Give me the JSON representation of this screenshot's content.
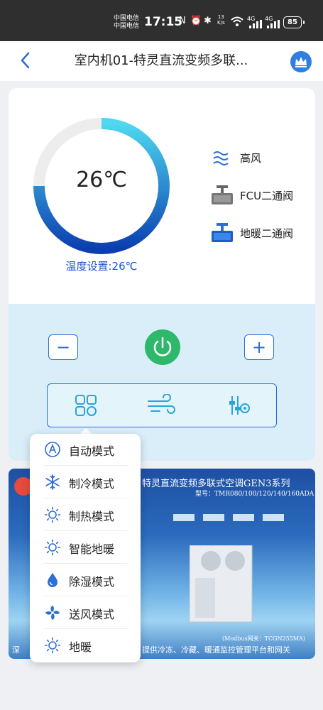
{
  "status_bar": {
    "carrier1": "中国电信",
    "carrier2": "中国电信",
    "time": "17:15",
    "speed_value": "13",
    "speed_unit": "K/s",
    "network1": "4G",
    "network2": "4G",
    "battery": "85"
  },
  "header": {
    "title": "室内机01-特灵直流变频多联..."
  },
  "thermostat": {
    "current_temp": "26℃",
    "setpoint_label": "温度设置:26℃"
  },
  "status": {
    "fan": "高风",
    "fcu_valve": "FCU二通阀",
    "floor_valve": "地暖二通阀"
  },
  "controls": {
    "minus": "−",
    "plus": "+"
  },
  "mode_menu": [
    {
      "label": "自动模式",
      "icon": "auto-mode-icon"
    },
    {
      "label": "制冷模式",
      "icon": "snowflake-icon"
    },
    {
      "label": "制热模式",
      "icon": "sun-icon"
    },
    {
      "label": "智能地暖",
      "icon": "sun-icon"
    },
    {
      "label": "除湿模式",
      "icon": "water-drop-icon"
    },
    {
      "label": "送风模式",
      "icon": "fan-icon"
    },
    {
      "label": "地暖",
      "icon": "sun-icon"
    }
  ],
  "banner": {
    "title": "特灵直流变频多联式空调GEN3系列",
    "model": "型号：TMR080/100/120/140/160ADA",
    "modbus": "(Modbus网关：TCGN255MA)",
    "bottom_text": "提供冷冻、冷藏、暖通监控管理平台和网关",
    "left_text": "深"
  },
  "colors": {
    "accent": "#2d6ed3",
    "power": "#2db86b",
    "ring_dark": "#0b3fb0",
    "ring_light": "#4fd8f0"
  }
}
